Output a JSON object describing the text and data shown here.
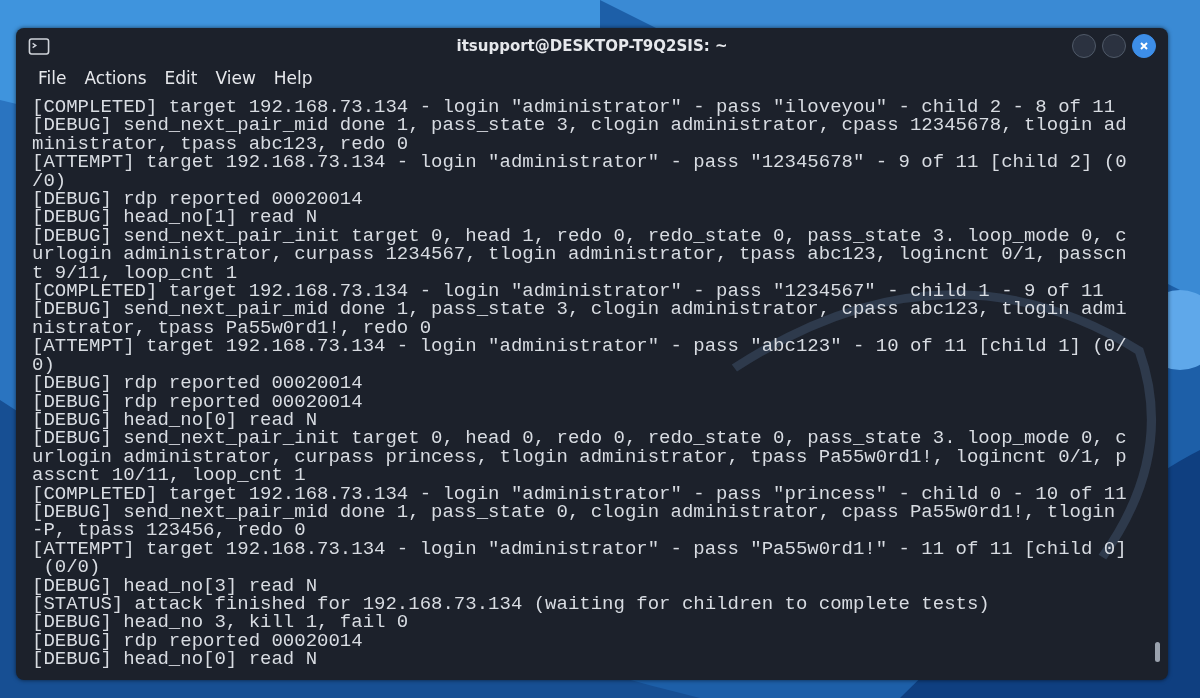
{
  "window": {
    "title": "itsupport@DESKTOP-T9Q2SIS: ~"
  },
  "menu": [
    "File",
    "Actions",
    "Edit",
    "View",
    "Help"
  ],
  "terminal_lines": [
    "[COMPLETED] target 192.168.73.134 - login \"administrator\" - pass \"iloveyou\" - child 2 - 8 of 11",
    "[DEBUG] send_next_pair_mid done 1, pass_state 3, clogin administrator, cpass 12345678, tlogin ad",
    "ministrator, tpass abc123, redo 0",
    "[ATTEMPT] target 192.168.73.134 - login \"administrator\" - pass \"12345678\" - 9 of 11 [child 2] (0",
    "/0)",
    "[DEBUG] rdp reported 00020014",
    "[DEBUG] head_no[1] read N",
    "[DEBUG] send_next_pair_init target 0, head 1, redo 0, redo_state 0, pass_state 3. loop_mode 0, c",
    "urlogin administrator, curpass 1234567, tlogin administrator, tpass abc123, logincnt 0/1, passcn",
    "t 9/11, loop_cnt 1",
    "[COMPLETED] target 192.168.73.134 - login \"administrator\" - pass \"1234567\" - child 1 - 9 of 11",
    "[DEBUG] send_next_pair_mid done 1, pass_state 3, clogin administrator, cpass abc123, tlogin admi",
    "nistrator, tpass Pa55w0rd1!, redo 0",
    "[ATTEMPT] target 192.168.73.134 - login \"administrator\" - pass \"abc123\" - 10 of 11 [child 1] (0/",
    "0)",
    "[DEBUG] rdp reported 00020014",
    "[DEBUG] rdp reported 00020014",
    "[DEBUG] head_no[0] read N",
    "[DEBUG] send_next_pair_init target 0, head 0, redo 0, redo_state 0, pass_state 3. loop_mode 0, c",
    "urlogin administrator, curpass princess, tlogin administrator, tpass Pa55w0rd1!, logincnt 0/1, p",
    "asscnt 10/11, loop_cnt 1",
    "[COMPLETED] target 192.168.73.134 - login \"administrator\" - pass \"princess\" - child 0 - 10 of 11",
    "[DEBUG] send_next_pair_mid done 1, pass_state 0, clogin administrator, cpass Pa55w0rd1!, tlogin",
    "-P, tpass 123456, redo 0",
    "[ATTEMPT] target 192.168.73.134 - login \"administrator\" - pass \"Pa55w0rd1!\" - 11 of 11 [child 0]",
    " (0/0)",
    "[DEBUG] head_no[3] read N",
    "[STATUS] attack finished for 192.168.73.134 (waiting for children to complete tests)",
    "[DEBUG] head_no 3, kill 1, fail 0",
    "[DEBUG] rdp reported 00020014",
    "[DEBUG] head_no[0] read N"
  ]
}
